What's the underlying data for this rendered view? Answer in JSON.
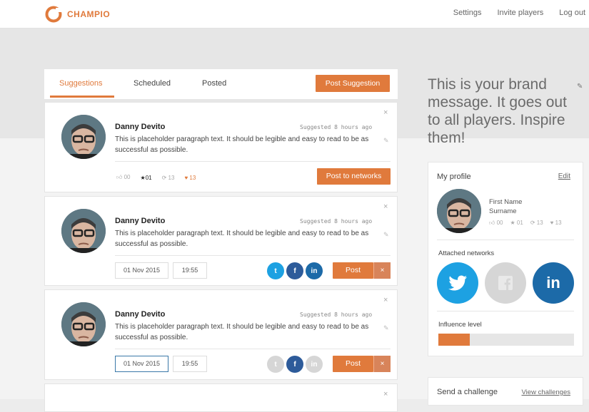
{
  "app": {
    "brand": "CHAMPIO"
  },
  "nav": {
    "settings": "Settings",
    "invite": "Invite players",
    "logout": "Log out"
  },
  "tabs": [
    {
      "label": "Suggestions"
    },
    {
      "label": "Scheduled"
    },
    {
      "label": "Posted"
    }
  ],
  "suggest_button": "Post Suggestion",
  "cards": [
    {
      "name": "Danny Devito",
      "time": "Suggested 8 hours ago",
      "close": "×",
      "text": "This is placeholder paragraph text. It should be legible and easy to read to be as successful as possible.",
      "stats": {
        "likes": "00",
        "stars": "01",
        "shares": "13",
        "hearts": "13"
      },
      "action": "Post to networks"
    },
    {
      "name": "Danny Devito",
      "time": "Suggested 8 hours ago",
      "close": "×",
      "text": "This is placeholder paragraph text. It should be legible and easy to read to be as successful as possible.",
      "date": "01 Nov 2015",
      "clock": "19:55",
      "post": "Post",
      "cancel": "×",
      "networks_active": [
        true,
        true,
        true
      ]
    },
    {
      "name": "Danny Devito",
      "time": "Suggested 8 hours ago",
      "close": "×",
      "text": "This is placeholder paragraph text. It should be legible and easy to read to be as successful as possible.",
      "date": "01 Nov 2015",
      "clock": "19:55",
      "post": "Post",
      "cancel": "×",
      "networks_active": [
        false,
        true,
        false
      ]
    },
    {
      "close": "×"
    }
  ],
  "brand_message": "This is your brand message. It goes out to all players. Inspire them!",
  "profile": {
    "title": "My profile",
    "edit": "Edit",
    "first_name": "First Name",
    "surname": "Surname",
    "stats": {
      "likes": "00",
      "stars": "01",
      "shares": "13",
      "hearts": "13"
    },
    "networks_label": "Attached networks",
    "networks": [
      {
        "name": "twitter",
        "attached": true
      },
      {
        "name": "facebook",
        "attached": false
      },
      {
        "name": "linkedin",
        "attached": true
      }
    ],
    "influence_label": "Influence level",
    "influence": 0.23
  },
  "challenge": {
    "title": "Send a challenge",
    "link": "View challenges"
  },
  "colors": {
    "accent": "#e07a3c",
    "twitter": "#1da1e2",
    "facebook": "#2d5b9a",
    "linkedin": "#1c6aa8",
    "inactive": "#d6d6d6"
  }
}
